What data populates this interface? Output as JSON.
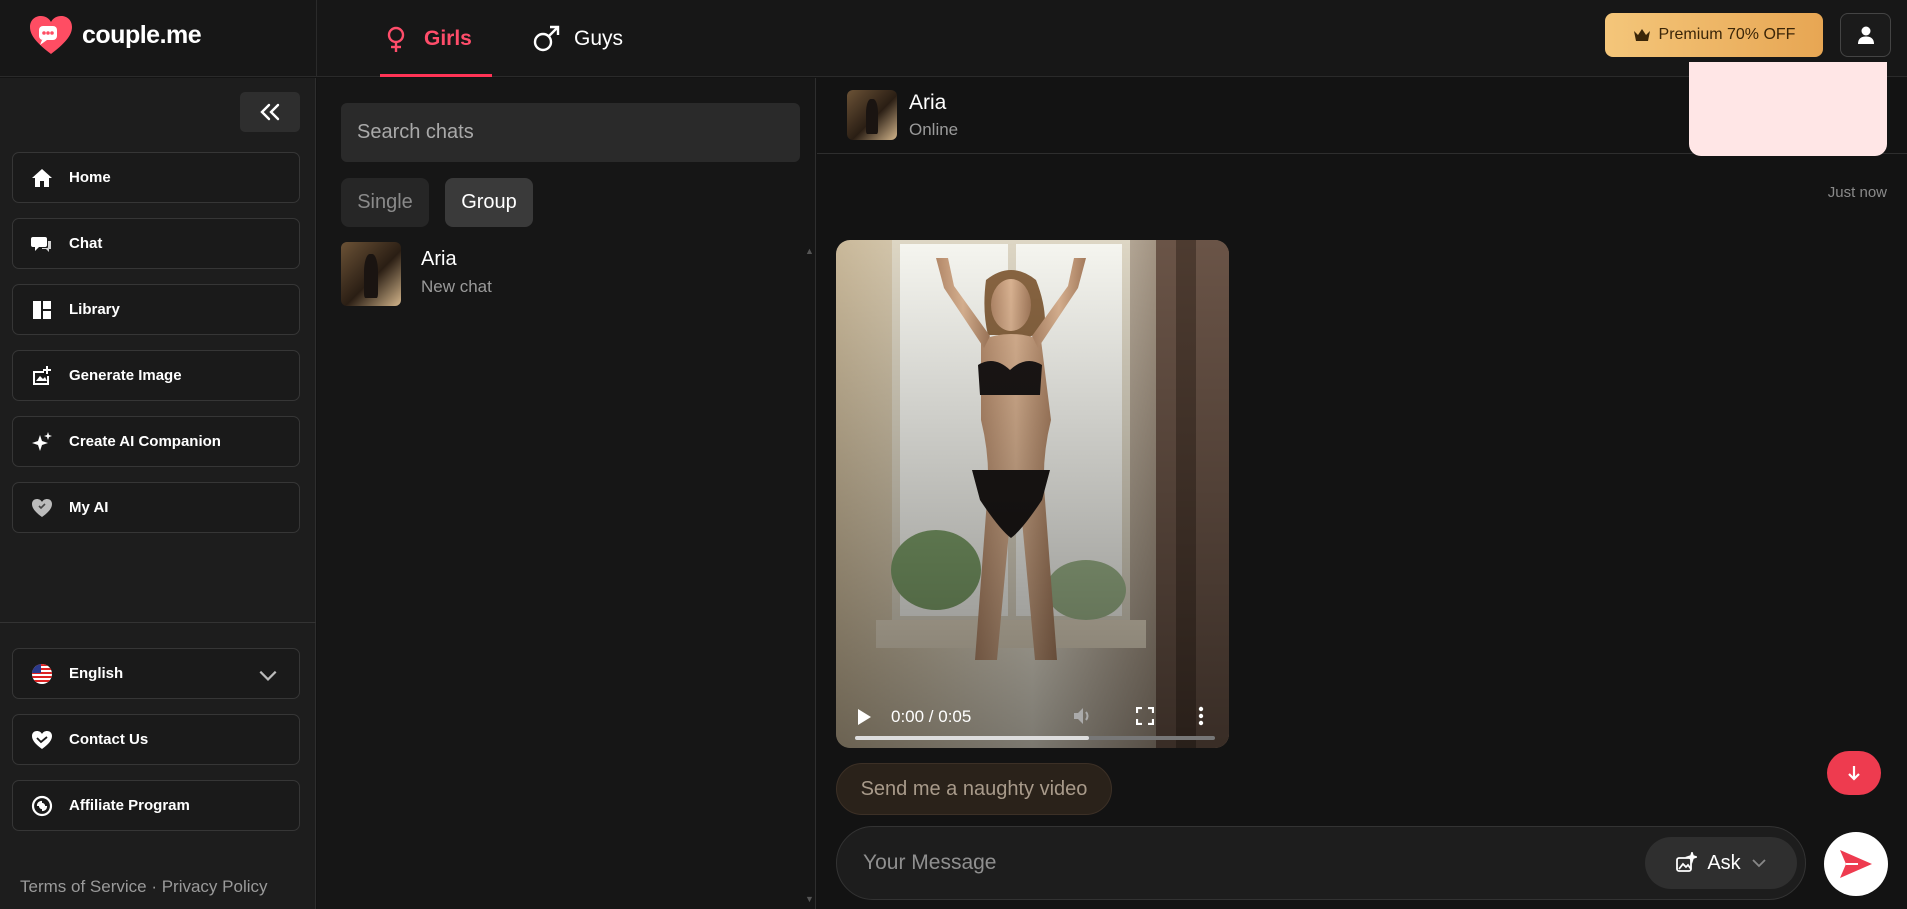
{
  "brand": {
    "name": "couple.me",
    "accent": "#ff3355"
  },
  "top_tabs": [
    {
      "label": "Girls",
      "active": true
    },
    {
      "label": "Guys",
      "active": false
    }
  ],
  "premium": {
    "label": "Premium 70% OFF",
    "icon": "crown-icon"
  },
  "sidebar": {
    "items": [
      {
        "label": "Home",
        "icon": "home-icon"
      },
      {
        "label": "Chat",
        "icon": "chat-icon"
      },
      {
        "label": "Library",
        "icon": "library-icon"
      },
      {
        "label": "Generate Image",
        "icon": "image-plus-icon"
      },
      {
        "label": "Create AI Companion",
        "icon": "sparkle-icon"
      },
      {
        "label": "My AI",
        "icon": "heart-icon"
      }
    ],
    "bottom_items": [
      {
        "label": "English",
        "icon": "us-flag-icon"
      },
      {
        "label": "Contact Us",
        "icon": "handshake-heart-icon"
      },
      {
        "label": "Affiliate Program",
        "icon": "affiliate-icon"
      }
    ],
    "footer": {
      "terms": "Terms of Service",
      "separator": " · ",
      "privacy": "Privacy Policy"
    }
  },
  "chat_list": {
    "search_placeholder": "Search chats",
    "filters": [
      {
        "label": "Single",
        "active": false
      },
      {
        "label": "Group",
        "active": true
      }
    ],
    "chats": [
      {
        "name": "Aria",
        "preview": "New chat"
      }
    ]
  },
  "chat": {
    "contact_name": "Aria",
    "contact_status": "Online",
    "last_message_time": "Just now",
    "video": {
      "time": "0:00 / 0:05",
      "progress": 0.65
    },
    "suggestion": "Send me a naughty video",
    "composer_placeholder": "Your Message",
    "ask_label": "Ask"
  }
}
